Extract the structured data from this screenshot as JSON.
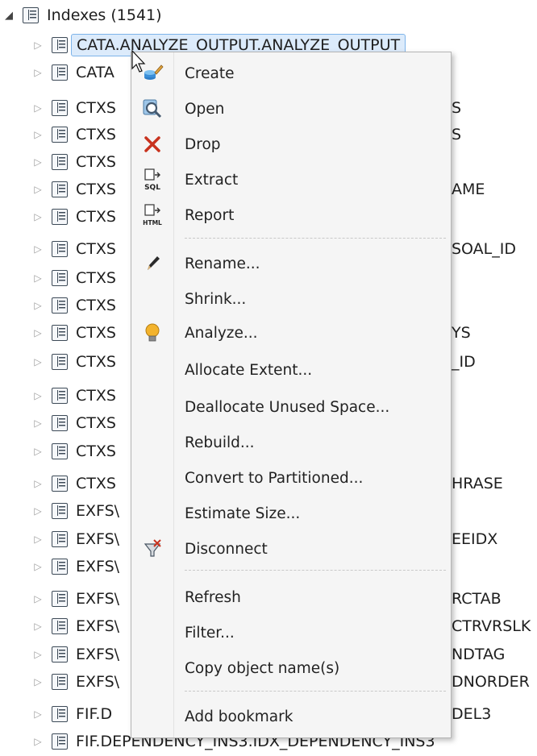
{
  "tree": {
    "root_label": "Indexes (1541)",
    "children": [
      {
        "label": "CATA.ANALYZE_OUTPUT.ANALYZE_OUTPUT",
        "tail": ""
      },
      {
        "label": "CATA",
        "tail": ""
      },
      {
        "label": "CTXS",
        "tail": "S"
      },
      {
        "label": "CTXS",
        "tail": "S"
      },
      {
        "label": "CTXS",
        "tail": ""
      },
      {
        "label": "CTXS",
        "tail": "AME"
      },
      {
        "label": "CTXS",
        "tail": ""
      },
      {
        "label": "CTXS",
        "tail": "SOAL_ID"
      },
      {
        "label": "CTXS",
        "tail": ""
      },
      {
        "label": "CTXS",
        "tail": ""
      },
      {
        "label": "CTXS",
        "tail": "YS"
      },
      {
        "label": "CTXS",
        "tail": "_ID"
      },
      {
        "label": "CTXS",
        "tail": ""
      },
      {
        "label": "CTXS",
        "tail": ""
      },
      {
        "label": "CTXS",
        "tail": ""
      },
      {
        "label": "CTXS",
        "tail": "HRASE"
      },
      {
        "label": "EXFS\\",
        "tail": ""
      },
      {
        "label": "EXFS\\",
        "tail": "EEIDX"
      },
      {
        "label": "EXFS\\",
        "tail": ""
      },
      {
        "label": "EXFS\\",
        "tail": "RCTAB"
      },
      {
        "label": "EXFS\\",
        "tail": "CTRVRSLK"
      },
      {
        "label": "EXFS\\",
        "tail": "NDTAG"
      },
      {
        "label": "EXFS\\",
        "tail": "DNORDER"
      },
      {
        "label": "FIF.D",
        "tail": "DEL3"
      },
      {
        "label": "FIF.DEPENDENCY_INS3.IDX_DEPENDENCY_INS3",
        "tail": ""
      }
    ]
  },
  "context_menu": {
    "items": [
      {
        "label": "Create",
        "icon": "create-icon"
      },
      {
        "label": "Open",
        "icon": "open-icon"
      },
      {
        "label": "Drop",
        "icon": "drop-icon"
      },
      {
        "label": "Extract",
        "icon": "extract-sql-icon"
      },
      {
        "label": "Report",
        "icon": "report-html-icon"
      },
      {
        "label": "Rename...",
        "icon": "rename-icon"
      },
      {
        "label": "Shrink...",
        "icon": ""
      },
      {
        "label": "Analyze...",
        "icon": "analyze-icon"
      },
      {
        "label": "Allocate Extent...",
        "icon": ""
      },
      {
        "label": "Deallocate Unused Space...",
        "icon": ""
      },
      {
        "label": "Rebuild...",
        "icon": ""
      },
      {
        "label": "Convert to Partitioned...",
        "icon": ""
      },
      {
        "label": "Estimate Size...",
        "icon": ""
      },
      {
        "label": "Disconnect",
        "icon": "disconnect-icon"
      },
      {
        "label": "Refresh",
        "icon": ""
      },
      {
        "label": "Filter...",
        "icon": ""
      },
      {
        "label": "Copy object name(s)",
        "icon": ""
      },
      {
        "label": "Add bookmark",
        "icon": ""
      }
    ],
    "icon_labels": {
      "sql": "SQL",
      "html": "HTML"
    }
  }
}
